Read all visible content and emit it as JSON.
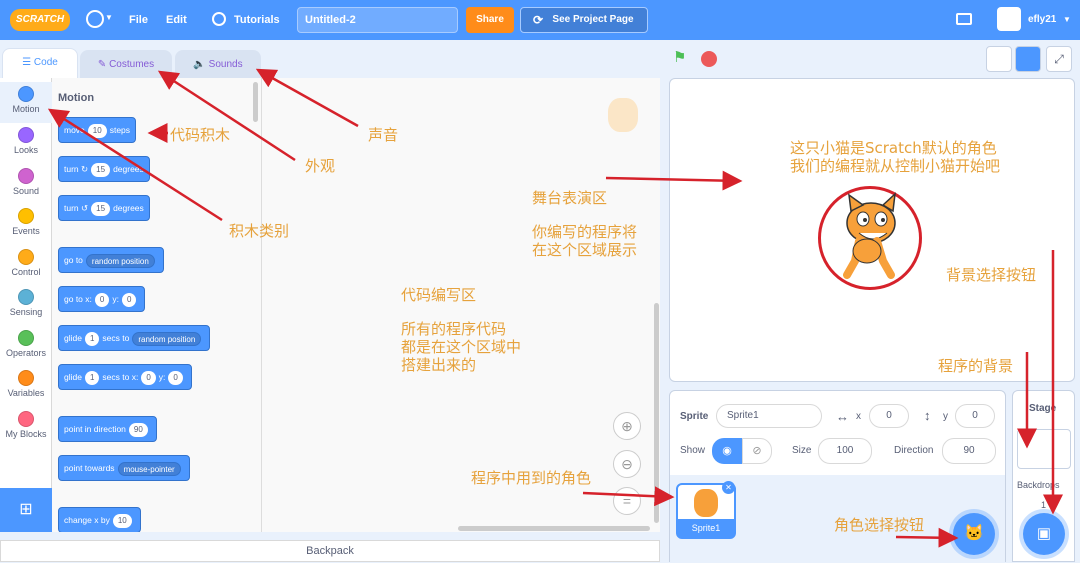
{
  "menubar": {
    "logo": "SCRATCH",
    "file": "File",
    "edit": "Edit",
    "tutorials": "Tutorials",
    "title_value": "Untitled-2",
    "share": "Share",
    "see_project": "See Project Page",
    "user": "efly21"
  },
  "tabs": {
    "code": "Code",
    "costumes": "Costumes",
    "sounds": "Sounds"
  },
  "categories": [
    {
      "label": "Motion",
      "color": "#4c97ff"
    },
    {
      "label": "Looks",
      "color": "#9966ff"
    },
    {
      "label": "Sound",
      "color": "#cf63cf"
    },
    {
      "label": "Events",
      "color": "#ffbf00"
    },
    {
      "label": "Control",
      "color": "#ffab19"
    },
    {
      "label": "Sensing",
      "color": "#5cb1d6"
    },
    {
      "label": "Operators",
      "color": "#59c059"
    },
    {
      "label": "Variables",
      "color": "#ff8c1a"
    },
    {
      "label": "My Blocks",
      "color": "#ff6680"
    }
  ],
  "palette": {
    "heading": "Motion",
    "b1": {
      "a": "move",
      "v": "10",
      "b": "steps"
    },
    "b2": {
      "a": "turn",
      "v": "15",
      "b": "degrees"
    },
    "b3": {
      "a": "turn",
      "v": "15",
      "b": "degrees"
    },
    "b4": {
      "a": "go to",
      "d": "random position"
    },
    "b5": {
      "a": "go to x:",
      "x": "0",
      "y_lbl": "y:",
      "y": "0"
    },
    "b6": {
      "a": "glide",
      "v": "1",
      "b": "secs to",
      "d": "random position"
    },
    "b7": {
      "a": "glide",
      "v": "1",
      "b": "secs to x:",
      "x": "0",
      "y_lbl": "y:",
      "y": "0"
    },
    "b8": {
      "a": "point in direction",
      "v": "90"
    },
    "b9": {
      "a": "point towards",
      "d": "mouse-pointer"
    },
    "b10": {
      "a": "change x by",
      "v": "10"
    }
  },
  "backpack": "Backpack",
  "sprite_info": {
    "sprite_label": "Sprite",
    "sprite_name": "Sprite1",
    "x_label": "x",
    "x": "0",
    "y_label": "y",
    "y": "0",
    "show_label": "Show",
    "size_label": "Size",
    "size": "100",
    "direction_label": "Direction",
    "direction": "90",
    "thumb_label": "Sprite1"
  },
  "stage_panel": {
    "title": "Stage",
    "backdrops_label": "Backdrops",
    "backdrops_count": "1"
  },
  "annotations": {
    "blocks": "代码积木",
    "sounds": "声音",
    "costumes": "外观",
    "categories": "积木类别",
    "stage": "舞台表演区",
    "stage_desc1": "你编写的程序将",
    "stage_desc2": "在这个区域展示",
    "code": "代码编写区",
    "code_desc1": "所有的程序代码",
    "code_desc2": "都是在这个区域中",
    "code_desc3": "搭建出来的",
    "cat1": "这只小猫是Scratch默认的角色",
    "cat2": "我们的编程就从控制小猫开始吧",
    "backdrop_btn": "背景选择按钮",
    "backdrop": "程序的背景",
    "sprites": "程序中用到的角色",
    "sprite_btn": "角色选择按钮"
  },
  "colors": {
    "brand": "#4c97ff",
    "annotation": "#e6a23c",
    "arrow": "#d6222b",
    "share": "#ff8c1a"
  }
}
